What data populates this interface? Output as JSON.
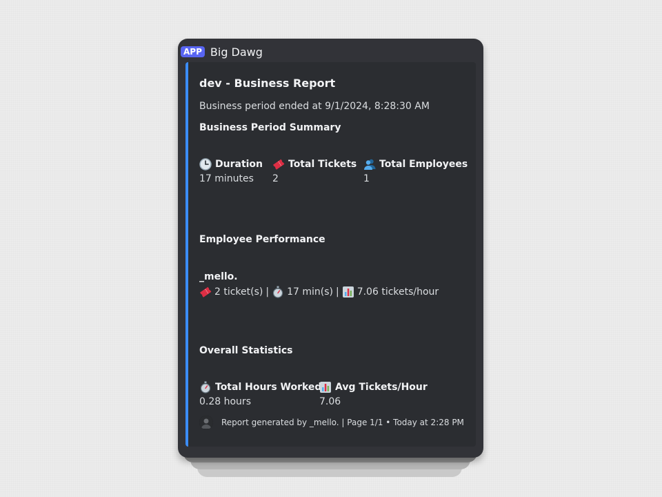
{
  "header": {
    "badge": "APP",
    "bot_name": "Big Dawg"
  },
  "embed": {
    "accent_color": "#3b8cf7",
    "title": "dev - Business Report",
    "description": "Business period ended at 9/1/2024, 8:28:30 AM",
    "summary_heading": "Business Period Summary",
    "summary_fields": [
      {
        "icon": "clock-icon",
        "name": "Duration",
        "value": "17 minutes"
      },
      {
        "icon": "ticket-icon",
        "name": "Total Tickets",
        "value": "2"
      },
      {
        "icon": "people-icon",
        "name": "Total Employees",
        "value": "1"
      }
    ],
    "performance_heading": "Employee Performance",
    "employee": {
      "name": "_mello.",
      "tickets": "2 ticket(s)",
      "time": "17 min(s)",
      "rate": "7.06 tickets/hour",
      "separator": "|"
    },
    "overall_heading": "Overall Statistics",
    "overall_fields": [
      {
        "icon": "stopwatch-icon",
        "name": "Total Hours Worked",
        "value": "0.28 hours"
      },
      {
        "icon": "bar-chart-icon",
        "name": "Avg Tickets/Hour",
        "value": "7.06"
      }
    ],
    "footer": {
      "text": "Report generated by _mello. | Page 1/1 • Today at 2:28 PM"
    }
  }
}
